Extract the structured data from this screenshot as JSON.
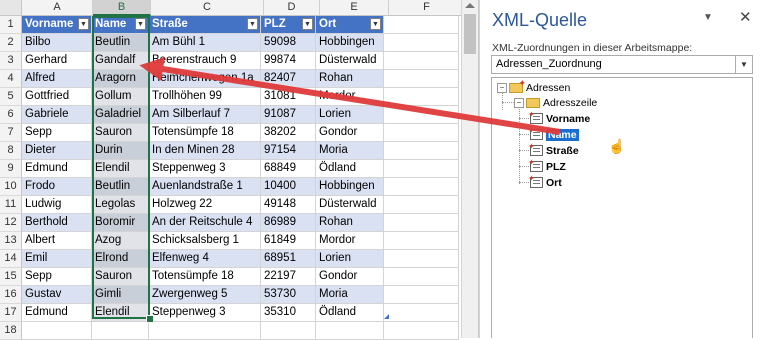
{
  "sheet": {
    "columns": [
      "A",
      "B",
      "C",
      "D",
      "E",
      "F"
    ],
    "selected_column": "B",
    "header_row": [
      "Vorname",
      "Name",
      "Straße",
      "PLZ",
      "Ort"
    ],
    "rows": [
      {
        "num": "1"
      },
      {
        "num": "2",
        "cells": [
          "Bilbo",
          "Beutlin",
          "Am Bühl 1",
          "59098",
          "Hobbingen"
        ]
      },
      {
        "num": "3",
        "cells": [
          "Gerhard",
          "Gandalf",
          "Beerenstrauch 9",
          "99874",
          "Düsterwald"
        ]
      },
      {
        "num": "4",
        "cells": [
          "Alfred",
          "Aragorn",
          "Heimchenwegen 1a",
          "82407",
          "Rohan"
        ]
      },
      {
        "num": "5",
        "cells": [
          "Gottfried",
          "Gollum",
          "Trollhöhen 99",
          "31081",
          "Mordor"
        ]
      },
      {
        "num": "6",
        "cells": [
          "Gabriele",
          "Galadriel",
          "Am Silberlauf 7",
          "91087",
          "Lorien"
        ]
      },
      {
        "num": "7",
        "cells": [
          "Sepp",
          "Sauron",
          "Totensümpfe 18",
          "38202",
          "Gondor"
        ]
      },
      {
        "num": "8",
        "cells": [
          "Dieter",
          "Durin",
          "In den Minen 28",
          "97154",
          "Moria"
        ]
      },
      {
        "num": "9",
        "cells": [
          "Edmund",
          "Elendil",
          "Steppenweg 3",
          "68849",
          "Ödland"
        ]
      },
      {
        "num": "10",
        "cells": [
          "Frodo",
          "Beutlin",
          "Auenlandstraße 1",
          "10400",
          "Hobbingen"
        ]
      },
      {
        "num": "11",
        "cells": [
          "Ludwig",
          "Legolas",
          "Holzweg 22",
          "49148",
          "Düsterwald"
        ]
      },
      {
        "num": "12",
        "cells": [
          "Berthold",
          "Boromir",
          "An der Reitschule 4",
          "86989",
          "Rohan"
        ]
      },
      {
        "num": "13",
        "cells": [
          "Albert",
          "Azog",
          "Schicksalsberg 1",
          "61849",
          "Mordor"
        ]
      },
      {
        "num": "14",
        "cells": [
          "Emil",
          "Elrond",
          "Elfenweg 4",
          "68951",
          "Lorien"
        ]
      },
      {
        "num": "15",
        "cells": [
          "Sepp",
          "Sauron",
          "Totensümpfe 18",
          "22197",
          "Gondor"
        ]
      },
      {
        "num": "16",
        "cells": [
          "Gustav",
          "Gimli",
          "Zwergenweg 5",
          "53730",
          "Moria"
        ]
      },
      {
        "num": "17",
        "cells": [
          "Edmund",
          "Elendil",
          "Steppenweg 3",
          "35310",
          "Ödland"
        ]
      },
      {
        "num": "18"
      }
    ]
  },
  "xml_pane": {
    "title": "XML-Quelle",
    "menu_icon": "chevron-down-icon",
    "close_icon": "close-icon",
    "mappings_label": "XML-Zuordnungen in dieser Arbeitsmappe:",
    "selected_mapping": "Adressen_Zuordnung",
    "tree": {
      "root": "Adressen",
      "child": "Adresszeile",
      "elements": [
        "Vorname",
        "Name",
        "Straße",
        "PLZ",
        "Ort"
      ],
      "selected": "Name"
    }
  },
  "colors": {
    "table_header": "#4472c4",
    "band": "#d9e1f2",
    "selection": "#217346",
    "arrow": "#e03a3a",
    "pane_title": "#2b579a"
  }
}
